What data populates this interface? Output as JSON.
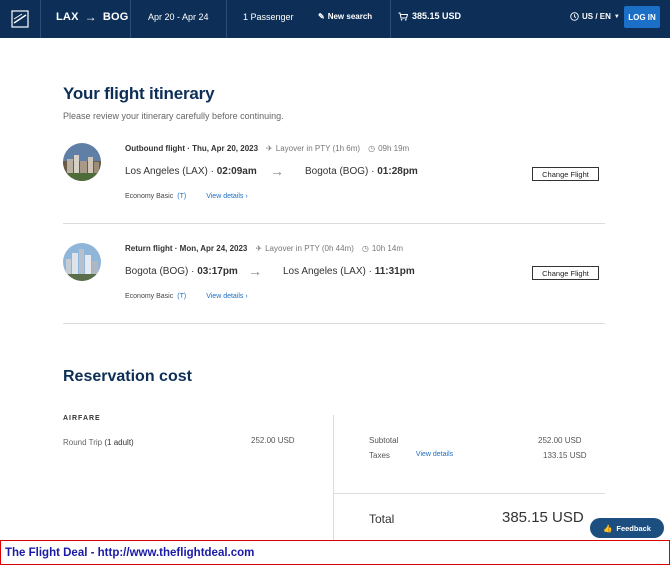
{
  "header": {
    "origin": "LAX",
    "destination": "BOG",
    "dates": "Apr 20 - Apr 24",
    "passengers": "1 Passenger",
    "new_search": "New search",
    "cart_total": "385.15 USD",
    "language": "US / EN",
    "login_label": "LOG IN"
  },
  "itinerary": {
    "title": "Your flight itinerary",
    "subtitle": "Please review your itinerary carefully before continuing.",
    "flights": [
      {
        "heading": "Outbound flight · Thu, Apr 20, 2023",
        "layover": "Layover in PTY (1h 6m)",
        "duration": "09h 19m",
        "from_city": "Los Angeles (LAX) · ",
        "from_time": "02:09am",
        "to_city": "Bogota (BOG) · ",
        "to_time": "01:28pm",
        "fare": "Economy Basic",
        "fare_code": "(T)",
        "details_label": "View details",
        "change_label": "Change Flight"
      },
      {
        "heading": "Return flight · Mon, Apr 24, 2023",
        "layover": "Layover in PTY (0h 44m)",
        "duration": "10h 14m",
        "from_city": "Bogota (BOG) · ",
        "from_time": "03:17pm",
        "to_city": "Los Angeles (LAX) · ",
        "to_time": "11:31pm",
        "fare": "Economy Basic",
        "fare_code": "(T)",
        "details_label": "View details",
        "change_label": "Change Flight"
      }
    ]
  },
  "cost": {
    "title": "Reservation cost",
    "section_label": "AIRFARE",
    "round_trip_label": "Round Trip",
    "round_trip_pax": "(1 adult)",
    "round_trip_value": "252.00 USD",
    "subtotal_label": "Subtotal",
    "subtotal_value": "252.00 USD",
    "taxes_label": "Taxes",
    "taxes_details": "View details",
    "taxes_value": "133.15 USD",
    "total_label": "Total",
    "total_value": "385.15 USD"
  },
  "feedback_label": "Feedback",
  "banner_text": "The Flight Deal - http://www.theflightdeal.com",
  "colors": {
    "header_bg": "#0d2f57",
    "accent": "#1c6fc6",
    "banner_border": "#dd0000",
    "banner_text": "#1a1aa8"
  }
}
